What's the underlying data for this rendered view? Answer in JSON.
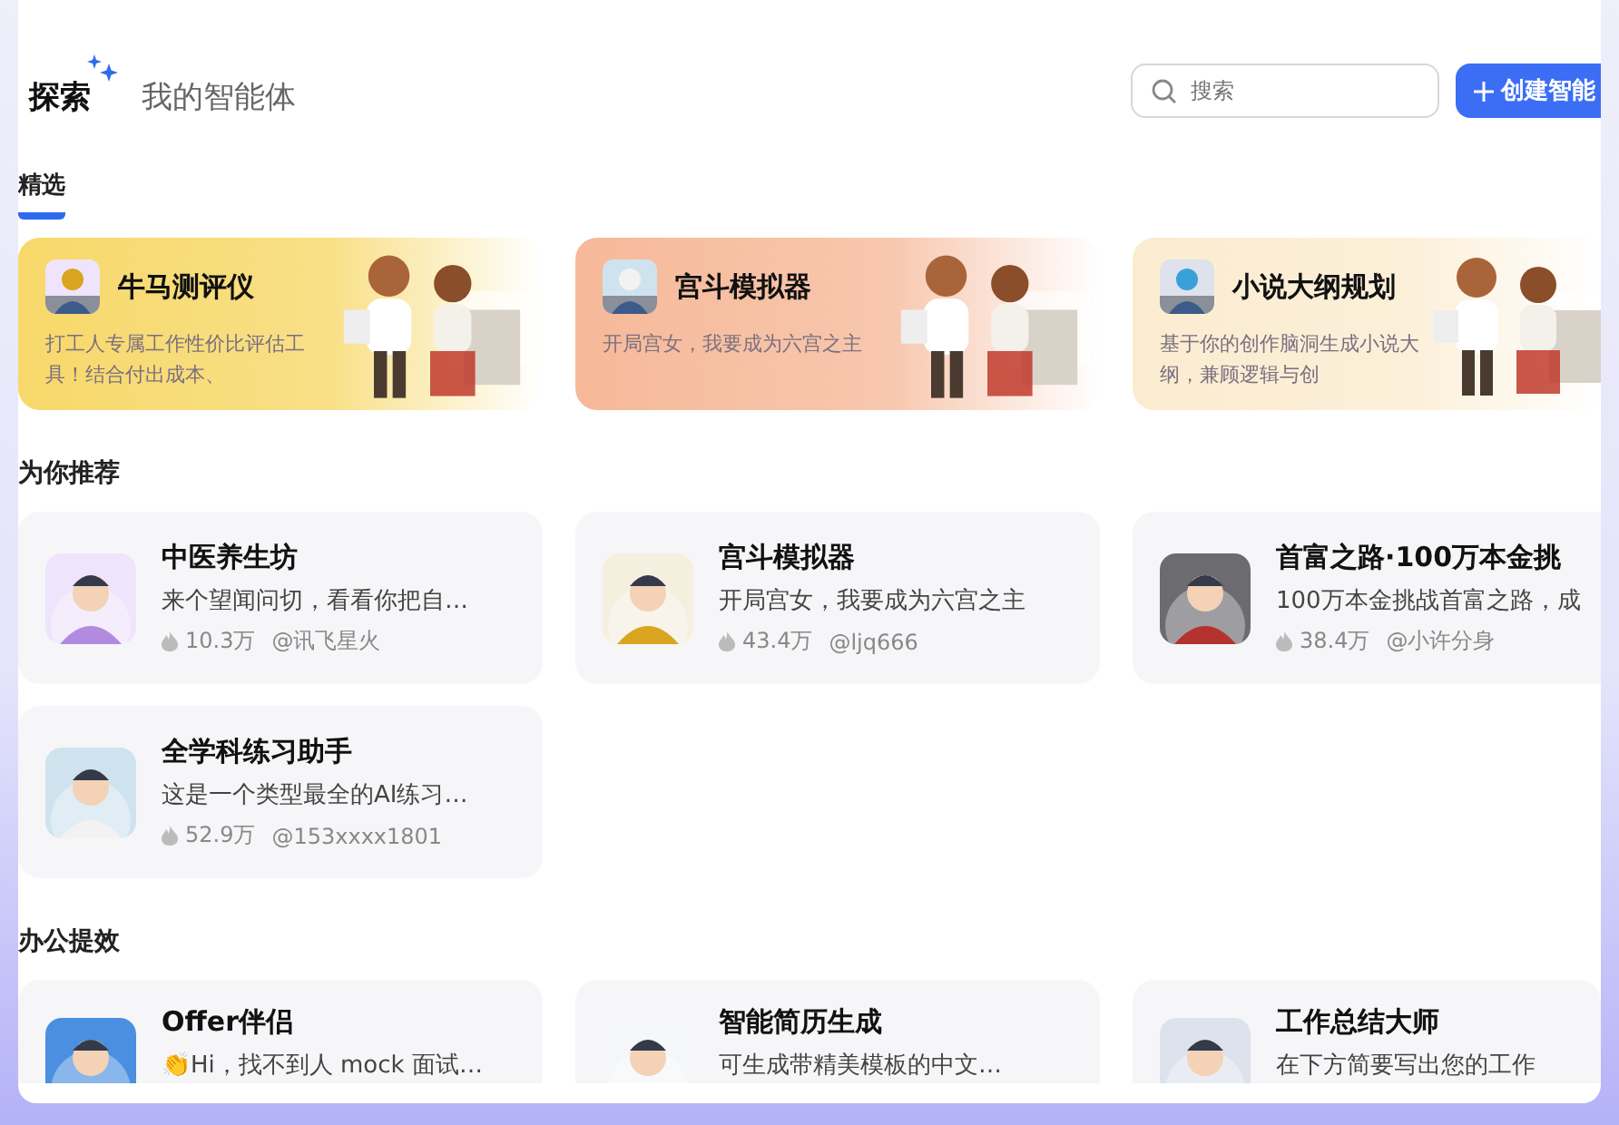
{
  "nav": {
    "tabs": [
      {
        "label": "探索",
        "selected": true
      },
      {
        "label": "我的智能体",
        "selected": false
      }
    ]
  },
  "search": {
    "placeholder": "搜索"
  },
  "create_button": {
    "label": "创建智能"
  },
  "sub_tabs": [
    {
      "label": "精选",
      "selected": true
    }
  ],
  "featured": [
    {
      "title": "牛马测评仪",
      "description": "打工人专属工作性价比评估工具！结合付出成本、",
      "color": "#f7d86a"
    },
    {
      "title": "宫斗模拟器",
      "description": "开局宫女，我要成为六宫之主",
      "color": "#f6b999"
    },
    {
      "title": "小说大纲规划",
      "description": "基于你的创作脑洞生成小说大纲，兼顾逻辑与创",
      "color": "#fbecd0"
    }
  ],
  "sections": [
    {
      "title": "为你推荐",
      "agents": [
        {
          "name": "中医养生坊",
          "description": "来个望闻问切，看看你把自…",
          "uses": "10.3万",
          "author": "@讯飞星火"
        },
        {
          "name": "宫斗模拟器",
          "description": "开局宫女，我要成为六宫之主",
          "uses": "43.4万",
          "author": "@ljq666"
        },
        {
          "name": "首富之路·100万本金挑",
          "description": "100万本金挑战首富之路，成",
          "uses": "38.4万",
          "author": "@小许分身"
        },
        {
          "name": "全学科练习助手",
          "description": "这是一个类型最全的AI练习…",
          "uses": "52.9万",
          "author": "@153xxxx1801"
        }
      ]
    },
    {
      "title": "办公提效",
      "agents": [
        {
          "name": "Offer伴侣",
          "description": "👏Hi，找不到人 mock 面试…"
        },
        {
          "name": "智能简历生成",
          "description": "可生成带精美模板的中文…"
        },
        {
          "name": "工作总结大师",
          "description": "在下方简要写出您的工作"
        }
      ]
    }
  ]
}
